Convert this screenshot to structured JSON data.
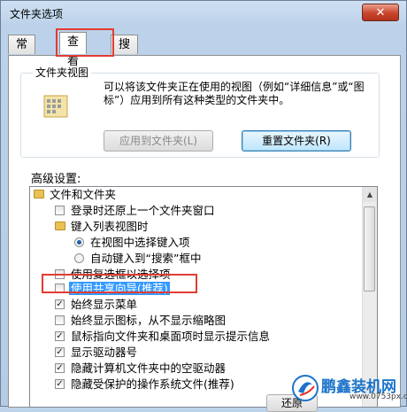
{
  "window": {
    "title": "文件夹选项",
    "close_glyph": "✕"
  },
  "tabs": [
    {
      "label": "常规",
      "active": false
    },
    {
      "label": "查看",
      "active": true
    },
    {
      "label": "搜索",
      "active": false
    }
  ],
  "folder_views": {
    "group_label": "文件夹视图",
    "description": "可以将该文件夹正在使用的视图（例如“详细信息”或“图标”）应用到所有这种类型的文件夹中。",
    "apply_button": "应用到文件夹(L)",
    "reset_button": "重置文件夹(R)"
  },
  "advanced": {
    "label": "高级设置:",
    "items": [
      {
        "type": "folder",
        "label": "文件和文件夹",
        "indent": 0
      },
      {
        "type": "checkbox",
        "label": "登录时还原上一个文件夹窗口",
        "checked": false,
        "indent": 1
      },
      {
        "type": "folder",
        "label": "键入列表视图时",
        "indent": 1
      },
      {
        "type": "radio",
        "label": "在视图中选择键入项",
        "checked": true,
        "indent": 2
      },
      {
        "type": "radio",
        "label": "自动键入到“搜索”框中",
        "checked": false,
        "indent": 2
      },
      {
        "type": "checkbox",
        "label": "使用复选框以选择项",
        "checked": false,
        "indent": 1
      },
      {
        "type": "checkbox",
        "label": "使用共享向导(推荐)",
        "checked": false,
        "indent": 1,
        "selected": true
      },
      {
        "type": "checkbox",
        "label": "始终显示菜单",
        "checked": true,
        "indent": 1
      },
      {
        "type": "checkbox",
        "label": "始终显示图标，从不显示缩略图",
        "checked": false,
        "indent": 1
      },
      {
        "type": "checkbox",
        "label": "鼠标指向文件夹和桌面项时显示提示信息",
        "checked": true,
        "indent": 1
      },
      {
        "type": "checkbox",
        "label": "显示驱动器号",
        "checked": true,
        "indent": 1
      },
      {
        "type": "checkbox",
        "label": "隐藏计算机文件夹中的空驱动器",
        "checked": true,
        "indent": 1
      },
      {
        "type": "checkbox",
        "label": "隐藏受保护的操作系统文件(推荐)",
        "checked": true,
        "indent": 1
      }
    ],
    "restore_button": "还原"
  },
  "watermark": {
    "brand": "鹏鑫装机网",
    "url": "www.0753px.com"
  },
  "colors": {
    "highlight": "#e23c32",
    "selection": "#3399ff"
  }
}
